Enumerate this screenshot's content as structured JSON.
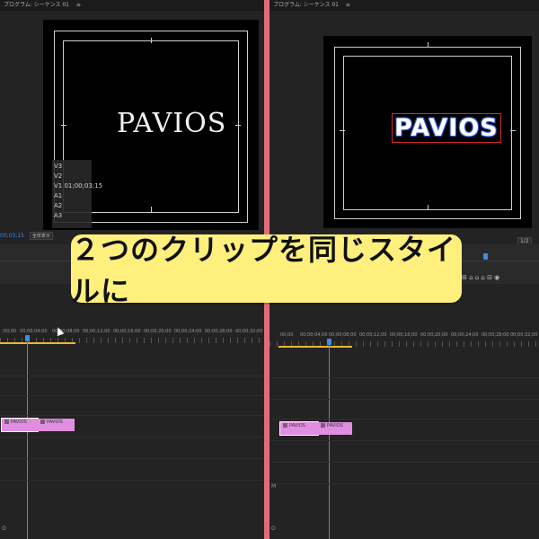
{
  "left": {
    "tab_title": "プログラム: シーケンス 01",
    "menu_icon": "≡",
    "monitor_text": "PAVIOS",
    "track_overlay": [
      "V3",
      "V2",
      "V1 01;00;03;15",
      "A1",
      "A2",
      "A3"
    ],
    "timecode": "00;03;15",
    "zoom_label": "全体表示",
    "ruler_labels": [
      ";00;00",
      "00;00;04;00",
      "00;00;08;00",
      "00;00;12;00",
      "00;00;16;00",
      "00;00;20;00",
      "00;00;24;00",
      "00;00;28;00",
      "00;00;32;00"
    ],
    "clips": [
      "PAVIOS",
      "PAVIOS"
    ],
    "bottom_label": "O"
  },
  "right": {
    "tab_title": "プログラム: シーケンス 01",
    "menu_icon": "≡",
    "monitor_text": "PAVIOS",
    "counter": "1/2",
    "ruler_labels": [
      "00;00",
      "00;00;04;00",
      "00;00;08;00",
      "00;00;12;00",
      "00;00;16;00",
      "00;00;20;00",
      "00;00;24;00",
      "00;00;28;00",
      "00;00;32;00"
    ],
    "clips": [
      "PAVIOS",
      "PAVIOS"
    ],
    "side_label": "M",
    "bottom_label": "O"
  },
  "banner_text": "２つのクリップを同じスタイルに",
  "icon_strip": "⊞ ⌂ ⌂ ⌂ ⊟ ◉",
  "colors": {
    "accent_divider": "#e16b78",
    "banner": "#fff07e",
    "clip": "#e08fe0",
    "playhead": "#3d8ee6",
    "inout": "#e8b833"
  }
}
